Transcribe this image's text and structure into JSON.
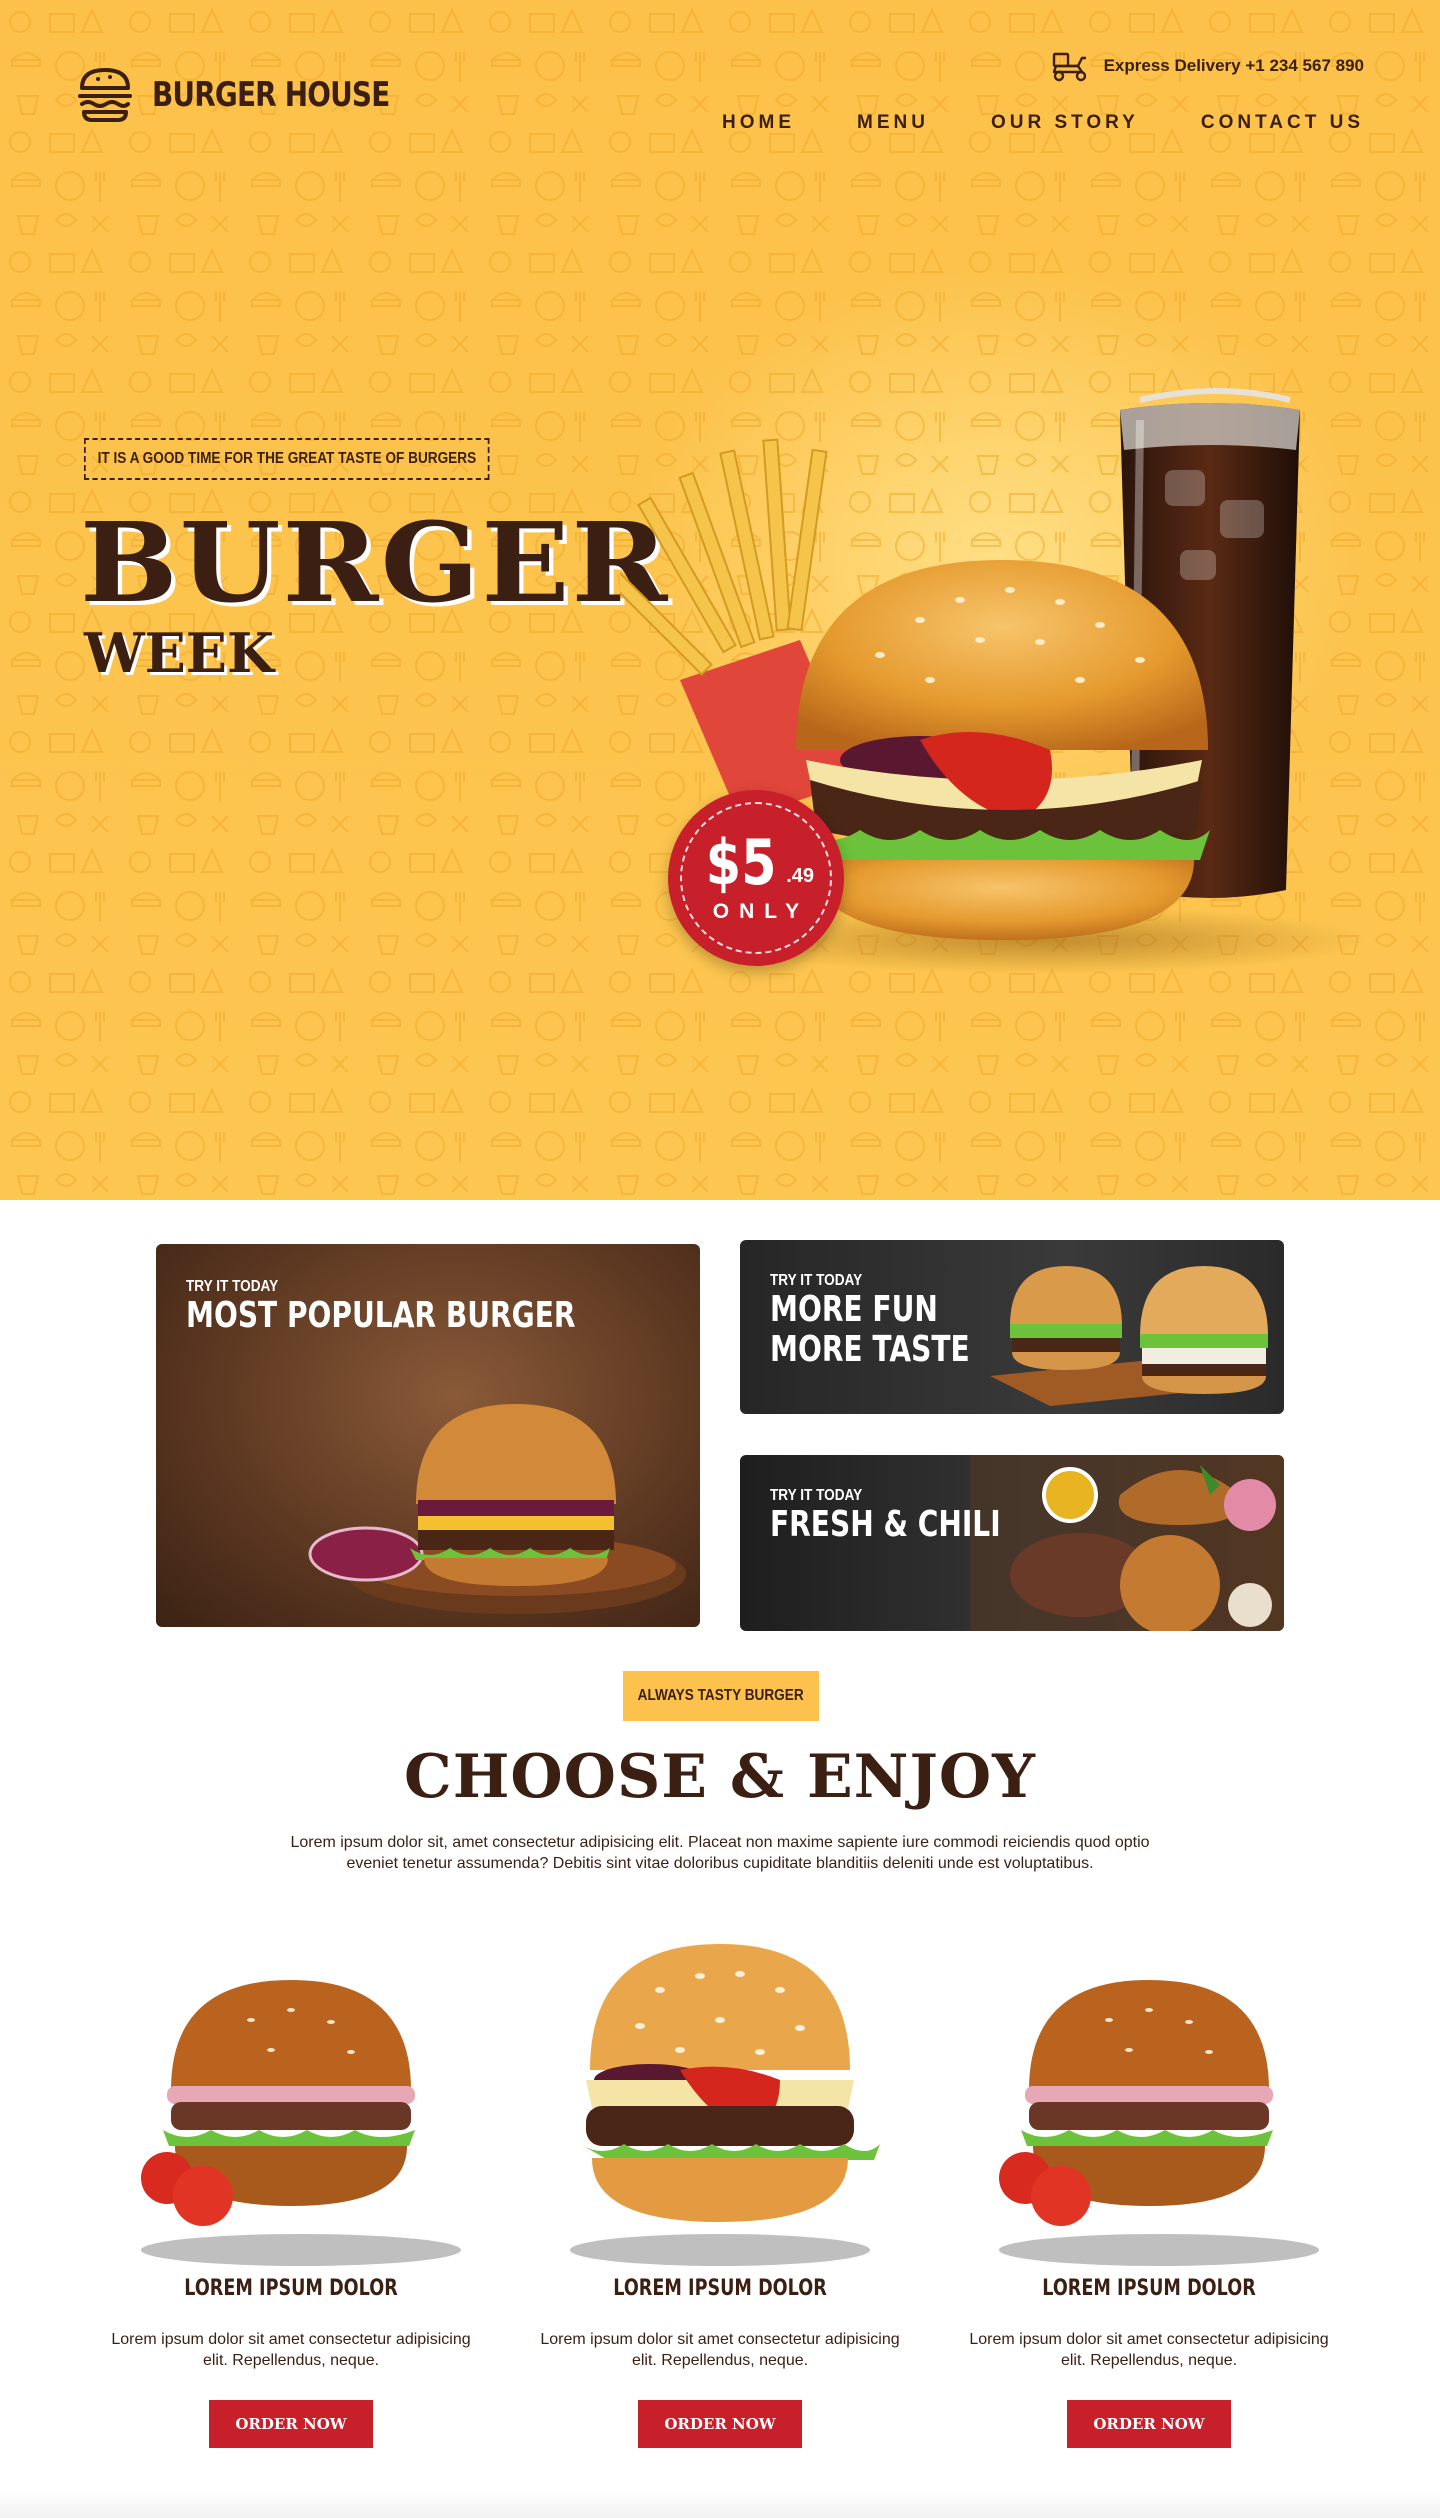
{
  "brand": {
    "name": "BURGER HOUSE"
  },
  "header": {
    "delivery_text": "Express Delivery +1 234 567 890",
    "nav": [
      {
        "label": "HOME"
      },
      {
        "label": "MENU"
      },
      {
        "label": "OUR STORY"
      },
      {
        "label": "CONTACT US"
      }
    ]
  },
  "hero": {
    "tagline": "IT IS A GOOD TIME FOR THE GREAT TASTE OF BURGERS",
    "title": "BURGER",
    "subtitle": "WEEK",
    "price": {
      "main": "$5",
      "cents": ".49",
      "label": "ONLY"
    }
  },
  "promos": [
    {
      "kicker": "TRY IT TODAY",
      "title_lines": [
        "MOST POPULAR BURGER"
      ]
    },
    {
      "kicker": "TRY IT TODAY",
      "title_lines": [
        "MORE FUN",
        "MORE TASTE"
      ]
    },
    {
      "kicker": "TRY IT TODAY",
      "title_lines": [
        "FRESH & CHILI"
      ]
    }
  ],
  "choose": {
    "badge": "ALWAYS TASTY BURGER",
    "title": "CHOOSE & ENJOY",
    "description": "Lorem ipsum dolor sit, amet consectetur adipisicing elit. Placeat non maxime sapiente iure commodi reiciendis quod optio eveniet tenetur assumenda? Debitis sint vitae doloribus cupiditate blanditiis deleniti unde est voluptatibus."
  },
  "products": [
    {
      "name": "LOREM IPSUM DOLOR",
      "description": "Lorem ipsum dolor sit amet consectetur adipisicing elit. Repellendus, neque.",
      "button": "ORDER NOW"
    },
    {
      "name": "LOREM IPSUM DOLOR",
      "description": "Lorem ipsum dolor sit amet consectetur adipisicing elit. Repellendus, neque.",
      "button": "ORDER NOW"
    },
    {
      "name": "LOREM IPSUM DOLOR",
      "description": "Lorem ipsum dolor sit amet consectetur adipisicing elit. Repellendus, neque.",
      "button": "ORDER NOW"
    }
  ],
  "colors": {
    "brand_dark": "#3a1f12",
    "accent_yellow": "#fdc24d",
    "accent_red": "#c8202a"
  },
  "icons": {
    "logo": "burger-icon",
    "delivery": "delivery-scooter-icon"
  }
}
